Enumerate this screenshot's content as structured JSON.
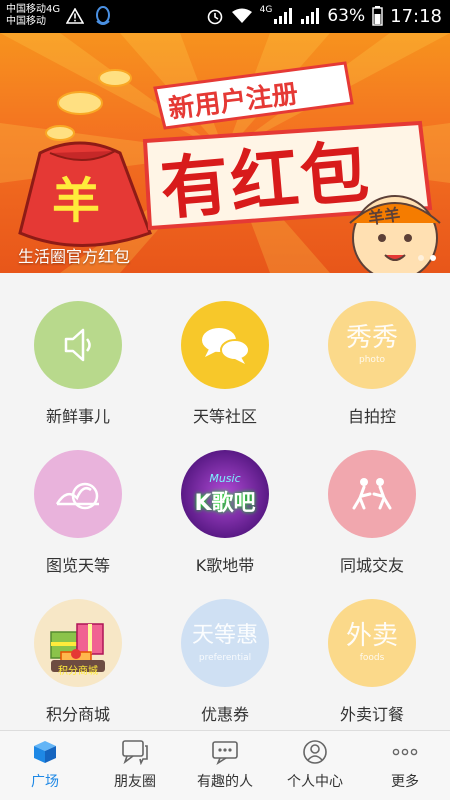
{
  "status_bar": {
    "carrier1": "中国移动4G",
    "carrier2": "中国移动",
    "network_badge": "4G",
    "battery_pct": "63%",
    "time": "17:18"
  },
  "banner": {
    "caption": "生活圈官方红包",
    "headline_small": "新用户注册",
    "headline_big": "有红包",
    "bag_symbol": "羊",
    "mascot_text": "羊羊"
  },
  "grid": [
    {
      "label": "新鲜事儿",
      "icon": "speaker-icon",
      "color": "#b8d98c"
    },
    {
      "label": "天等社区",
      "icon": "chat-bubbles-icon",
      "color": "#f7c82a"
    },
    {
      "label": "自拍控",
      "icon": "photo-icon",
      "color": "#fbd98a",
      "watermark": "秀秀",
      "sub": "photo"
    },
    {
      "label": "图览天等",
      "icon": "scenery-icon",
      "color": "#e9b3dc"
    },
    {
      "label": "K歌地带",
      "icon": "karaoke-icon",
      "color": "#7a2fa8",
      "watermark": "K歌吧",
      "sub": "Music"
    },
    {
      "label": "同城交友",
      "icon": "friends-icon",
      "color": "#f1a7ae"
    },
    {
      "label": "积分商城",
      "icon": "gift-icon",
      "color": "#f7e7c6",
      "watermark": "积分商城"
    },
    {
      "label": "优惠券",
      "icon": "coupon-icon",
      "color": "#cfe0f3",
      "watermark": "天等惠",
      "sub": "preferential"
    },
    {
      "label": "外卖订餐",
      "icon": "takeout-icon",
      "color": "#fbd98a",
      "watermark": "外卖",
      "sub": "foods"
    }
  ],
  "tabs": [
    {
      "label": "广场",
      "icon": "cube-icon",
      "active": true
    },
    {
      "label": "朋友圈",
      "icon": "chat-icon"
    },
    {
      "label": "有趣的人",
      "icon": "message-dots-icon"
    },
    {
      "label": "个人中心",
      "icon": "person-icon"
    },
    {
      "label": "更多",
      "icon": "more-dots-icon"
    }
  ],
  "colors": {
    "accent": "#1e88e5",
    "banner_orange": "#f37021",
    "banner_red": "#d9201b"
  }
}
